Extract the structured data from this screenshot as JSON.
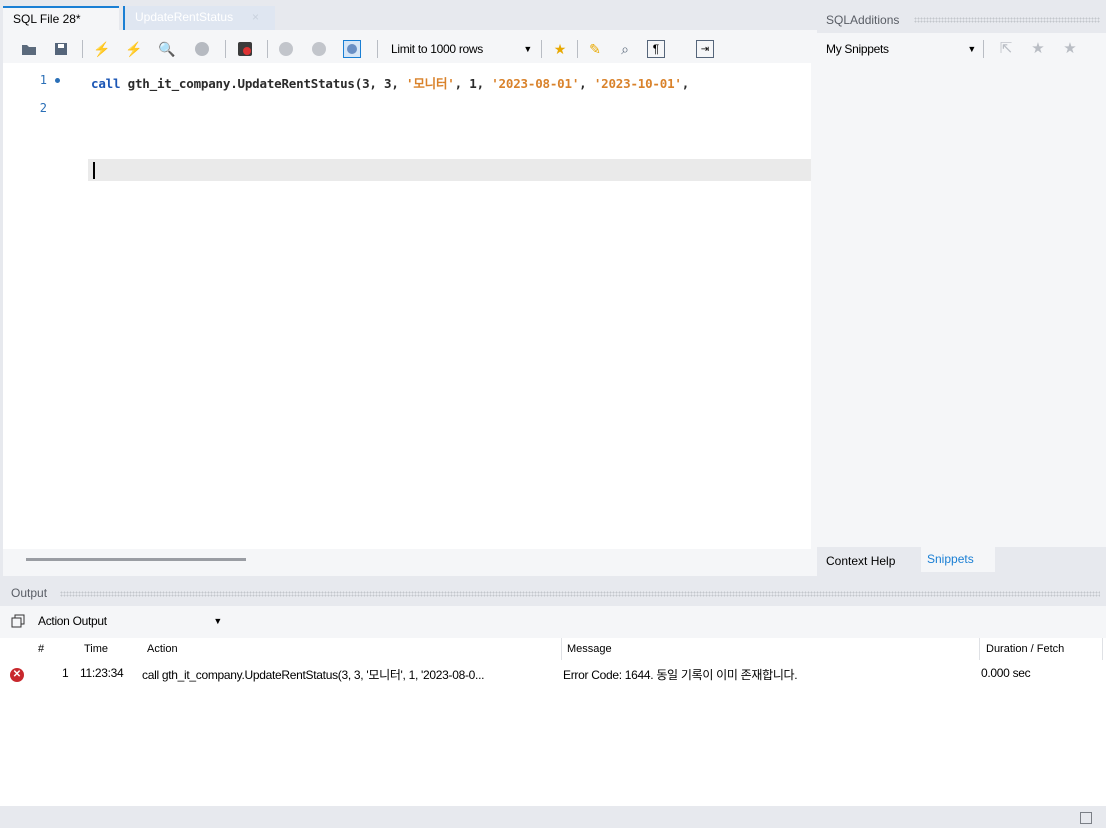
{
  "tabs": [
    {
      "label": "SQL File 28*"
    },
    {
      "label": "UpdateRentStatus",
      "close": "×"
    }
  ],
  "toolbar": {
    "limit_select": "Limit to 1000 rows",
    "icons": [
      "open-folder-icon",
      "save-icon",
      "execute-icon",
      "execute-current-icon",
      "explain-icon",
      "stop-icon",
      "toggle-error-icon",
      "commit-icon",
      "rollback-icon",
      "autocommit-icon",
      "add-snippet-icon",
      "beautify-icon",
      "find-icon",
      "invisible-chars-icon",
      "wrap-icon"
    ]
  },
  "editor": {
    "lines": [
      {
        "number": "1",
        "tokens": [
          {
            "type": "kw",
            "text": "call "
          },
          {
            "type": "id",
            "text": "gth_it_company.UpdateRentStatus("
          },
          {
            "type": "num",
            "text": "3, 3, "
          },
          {
            "type": "str",
            "text": "'모니터'"
          },
          {
            "type": "num",
            "text": ", 1, "
          },
          {
            "type": "str",
            "text": "'2023-08-01'"
          },
          {
            "type": "num",
            "text": ", "
          },
          {
            "type": "str",
            "text": "'2023-10-01'"
          },
          {
            "type": "num",
            "text": ","
          }
        ]
      },
      {
        "number": "2",
        "tokens": []
      }
    ]
  },
  "sql_additions": {
    "title": "SQLAdditions",
    "snippets_select": "My Snippets",
    "tabs": {
      "context_help": "Context Help",
      "snippets": "Snippets"
    }
  },
  "output": {
    "title": "Output",
    "select": "Action Output",
    "columns": [
      "#",
      "Time",
      "Action",
      "Message",
      "Duration / Fetch"
    ],
    "rows": [
      {
        "status": "error",
        "num": "1",
        "time": "11:23:34",
        "action": "call gth_it_company.UpdateRentStatus(3, 3, '모니터', 1, '2023-08-0...",
        "message": "Error Code: 1644. 동일 기록이 이미 존재합니다.",
        "duration": "0.000 sec"
      }
    ]
  },
  "colors": {
    "accent": "#1a7fd4",
    "keyword": "#1b56b5",
    "string": "#d9822b",
    "error": "#c8282d"
  }
}
